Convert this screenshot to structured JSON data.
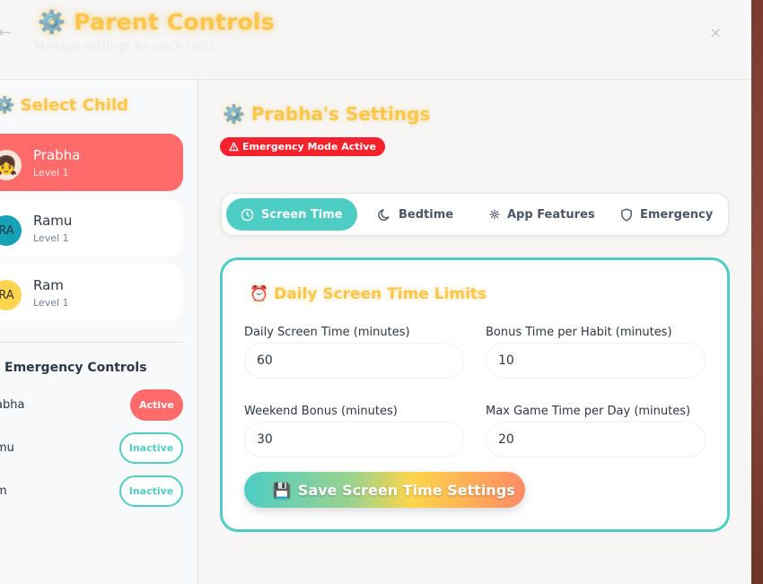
{
  "header": {
    "back_glyph": "←",
    "title": "⚙️ Parent Controls",
    "subtitle": "Manage settings for each child",
    "close_glyph": "×"
  },
  "sidebar": {
    "heading": "⚙️ Select Child",
    "children": [
      {
        "name": "Prabha",
        "level": "Level 1",
        "avatar": "👧",
        "selected": true
      },
      {
        "name": "Ramu",
        "level": "Level 1",
        "avatar": "RA",
        "selected": false
      },
      {
        "name": "Ram",
        "level": "Level 1",
        "avatar": "RA",
        "selected": false
      }
    ],
    "emergency_heading": "Emergency Controls",
    "emergency_rows": [
      {
        "name": "Prabha",
        "visible_name": "abha",
        "status": "Active"
      },
      {
        "name": "Ramu",
        "visible_name": "mu",
        "status": "Inactive"
      },
      {
        "name": "Ram",
        "visible_name": "m",
        "status": "Inactive"
      }
    ]
  },
  "main": {
    "title": "⚙️ Prabha's Settings",
    "badge": "Emergency Mode Active",
    "tabs": [
      {
        "label": "Screen Time",
        "icon": "clock-icon",
        "active": true
      },
      {
        "label": "Bedtime",
        "icon": "moon-icon",
        "active": false
      },
      {
        "label": "App Features",
        "icon": "gear-icon",
        "active": false
      },
      {
        "label": "Emergency",
        "icon": "shield-icon",
        "active": false
      }
    ],
    "card": {
      "title": "⏰ Daily Screen Time Limits",
      "fields": [
        {
          "label": "Daily Screen Time (minutes)",
          "value": "60"
        },
        {
          "label": "Bonus Time per Habit (minutes)",
          "value": "10"
        },
        {
          "label": "Weekend Bonus (minutes)",
          "value": "30"
        },
        {
          "label": "Max Game Time per Day (minutes)",
          "value": "20"
        }
      ],
      "save_icon": "💾",
      "save_label": "Save Screen Time Settings"
    }
  },
  "colors": {
    "accent_teal": "#4ecdc4",
    "accent_coral": "#ff6b6b",
    "title_yellow": "#fbc64a",
    "badge_red": "#f5222d"
  }
}
